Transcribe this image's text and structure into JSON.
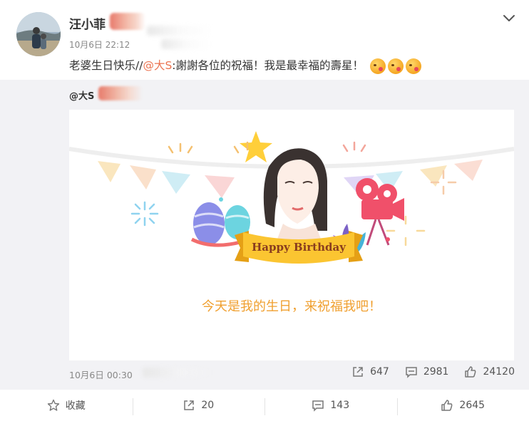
{
  "header": {
    "username": "汪小菲",
    "timestamp": "10月6日 22:12",
    "text_prefix": "老婆生日快乐//",
    "mention": "@大S",
    "text_suffix": ":謝謝各位的祝福！我是最幸福的壽星！",
    "emoji_names": [
      "kiss-emoji",
      "kiss-emoji",
      "kiss-emoji"
    ]
  },
  "repost": {
    "author": "@大S",
    "card": {
      "banner_text": "Happy Birthday",
      "caption": "今天是我的生日，来祝福我吧！"
    },
    "timestamp": "10月6日 00:30",
    "stats": {
      "reposts": "647",
      "comments": "2981",
      "likes": "24120"
    }
  },
  "footer": {
    "favorite_label": "收藏",
    "repost_count": "20",
    "comment_count": "143",
    "like_count": "2645"
  },
  "colors": {
    "mention": "#eb7350",
    "caption": "#f0a030",
    "repost_bg": "#f2f2f5"
  }
}
